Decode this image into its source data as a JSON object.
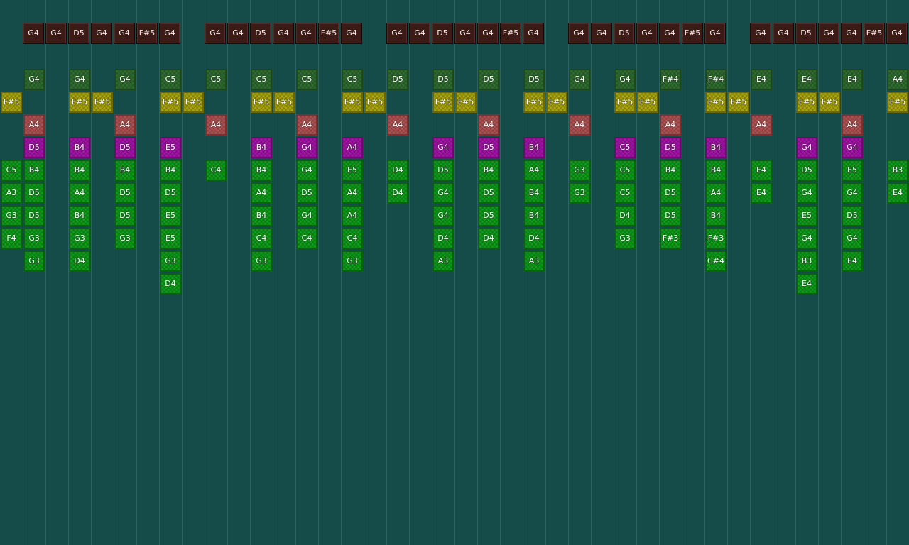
{
  "pattern": [
    [
      "G4",
      "G4",
      "D5",
      "G4",
      "G4",
      "F#5",
      "G4"
    ],
    [
      "G4",
      "G4",
      "D5",
      "G4",
      "G4",
      "F#5",
      "G4"
    ],
    [
      "G4",
      "G4",
      "D5",
      "G4",
      "G4",
      "F#5",
      "G4"
    ],
    [
      "G4",
      "G4",
      "D5",
      "G4",
      "G4",
      "F#5",
      "G4"
    ],
    [
      "G4",
      "G4",
      "D5",
      "G4",
      "G4",
      "F#5",
      "G4"
    ]
  ],
  "note_colors": {
    "dg": "#2f6b2f",
    "y": "#a8a40e",
    "r": "#ad5252",
    "m": "#a214a6",
    "g": "#0f9a1a"
  },
  "columns": [
    {
      "col": 0,
      "notes": [
        {
          "row": 1,
          "t": "y",
          "l": "F#5"
        },
        {
          "row": 4,
          "t": "g",
          "l": "C5"
        },
        {
          "row": 5,
          "t": "g",
          "l": "A3"
        },
        {
          "row": 6,
          "t": "g",
          "l": "G3"
        },
        {
          "row": 7,
          "t": "g",
          "l": "F4"
        }
      ]
    },
    {
      "col": 1,
      "notes": [
        {
          "row": 0,
          "t": "dg",
          "l": "G4"
        },
        {
          "row": 2,
          "t": "r",
          "l": "A4"
        },
        {
          "row": 3,
          "t": "m",
          "l": "D5"
        },
        {
          "row": 4,
          "t": "g",
          "l": "B4"
        },
        {
          "row": 5,
          "t": "g",
          "l": "D5"
        },
        {
          "row": 6,
          "t": "g",
          "l": "D5"
        },
        {
          "row": 7,
          "t": "g",
          "l": "G3"
        },
        {
          "row": 8,
          "t": "g",
          "l": "G3"
        }
      ]
    },
    {
      "col": 3,
      "notes": [
        {
          "row": 0,
          "t": "dg",
          "l": "G4"
        },
        {
          "row": 1,
          "t": "y",
          "l": "F#5"
        },
        {
          "row": 3,
          "t": "m",
          "l": "B4"
        },
        {
          "row": 4,
          "t": "g",
          "l": "B4"
        },
        {
          "row": 5,
          "t": "g",
          "l": "A4"
        },
        {
          "row": 6,
          "t": "g",
          "l": "B4"
        },
        {
          "row": 7,
          "t": "g",
          "l": "G3"
        },
        {
          "row": 8,
          "t": "g",
          "l": "D4"
        }
      ]
    },
    {
      "col": 4,
      "notes": [
        {
          "row": 1,
          "t": "y",
          "l": "F#5"
        }
      ]
    },
    {
      "col": 5,
      "notes": [
        {
          "row": 0,
          "t": "dg",
          "l": "G4"
        },
        {
          "row": 2,
          "t": "r",
          "l": "A4"
        },
        {
          "row": 3,
          "t": "m",
          "l": "D5"
        },
        {
          "row": 4,
          "t": "g",
          "l": "B4"
        },
        {
          "row": 5,
          "t": "g",
          "l": "D5"
        },
        {
          "row": 6,
          "t": "g",
          "l": "D5"
        },
        {
          "row": 7,
          "t": "g",
          "l": "G3"
        }
      ]
    },
    {
      "col": 7,
      "notes": [
        {
          "row": 0,
          "t": "dg",
          "l": "C5"
        },
        {
          "row": 1,
          "t": "y",
          "l": "F#5"
        },
        {
          "row": 3,
          "t": "m",
          "l": "E5"
        },
        {
          "row": 4,
          "t": "g",
          "l": "B4"
        },
        {
          "row": 5,
          "t": "g",
          "l": "D5"
        },
        {
          "row": 6,
          "t": "g",
          "l": "E5"
        },
        {
          "row": 7,
          "t": "g",
          "l": "E5"
        },
        {
          "row": 8,
          "t": "g",
          "l": "G3"
        },
        {
          "row": 9,
          "t": "g",
          "l": "D4"
        }
      ]
    },
    {
      "col": 8,
      "notes": [
        {
          "row": 1,
          "t": "y",
          "l": "F#5"
        }
      ]
    },
    {
      "col": 9,
      "notes": [
        {
          "row": 0,
          "t": "dg",
          "l": "C5"
        },
        {
          "row": 2,
          "t": "r",
          "l": "A4"
        },
        {
          "row": 4,
          "t": "g",
          "l": "C4"
        }
      ]
    },
    {
      "col": 11,
      "notes": [
        {
          "row": 0,
          "t": "dg",
          "l": "C5"
        },
        {
          "row": 1,
          "t": "y",
          "l": "F#5"
        },
        {
          "row": 3,
          "t": "m",
          "l": "B4"
        },
        {
          "row": 4,
          "t": "g",
          "l": "B4"
        },
        {
          "row": 5,
          "t": "g",
          "l": "A4"
        },
        {
          "row": 6,
          "t": "g",
          "l": "B4"
        },
        {
          "row": 7,
          "t": "g",
          "l": "C4"
        },
        {
          "row": 8,
          "t": "g",
          "l": "G3"
        }
      ]
    },
    {
      "col": 12,
      "notes": [
        {
          "row": 1,
          "t": "y",
          "l": "F#5"
        }
      ]
    },
    {
      "col": 13,
      "notes": [
        {
          "row": 0,
          "t": "dg",
          "l": "C5"
        },
        {
          "row": 2,
          "t": "r",
          "l": "A4"
        },
        {
          "row": 3,
          "t": "m",
          "l": "G4"
        },
        {
          "row": 4,
          "t": "g",
          "l": "G4"
        },
        {
          "row": 5,
          "t": "g",
          "l": "D5"
        },
        {
          "row": 6,
          "t": "g",
          "l": "G4"
        },
        {
          "row": 7,
          "t": "g",
          "l": "C4"
        }
      ]
    },
    {
      "col": 15,
      "notes": [
        {
          "row": 0,
          "t": "dg",
          "l": "C5"
        },
        {
          "row": 1,
          "t": "y",
          "l": "F#5"
        },
        {
          "row": 3,
          "t": "m",
          "l": "A4"
        },
        {
          "row": 4,
          "t": "g",
          "l": "E5"
        },
        {
          "row": 5,
          "t": "g",
          "l": "A4"
        },
        {
          "row": 6,
          "t": "g",
          "l": "A4"
        },
        {
          "row": 7,
          "t": "g",
          "l": "C4"
        },
        {
          "row": 8,
          "t": "g",
          "l": "G3"
        }
      ]
    },
    {
      "col": 16,
      "notes": [
        {
          "row": 1,
          "t": "y",
          "l": "F#5"
        }
      ]
    },
    {
      "col": 17,
      "notes": [
        {
          "row": 0,
          "t": "dg",
          "l": "D5"
        },
        {
          "row": 2,
          "t": "r",
          "l": "A4"
        },
        {
          "row": 4,
          "t": "g",
          "l": "D4"
        },
        {
          "row": 5,
          "t": "g",
          "l": "D4"
        }
      ]
    },
    {
      "col": 19,
      "notes": [
        {
          "row": 0,
          "t": "dg",
          "l": "D5"
        },
        {
          "row": 1,
          "t": "y",
          "l": "F#5"
        },
        {
          "row": 3,
          "t": "m",
          "l": "G4"
        },
        {
          "row": 4,
          "t": "g",
          "l": "D5"
        },
        {
          "row": 5,
          "t": "g",
          "l": "G4"
        },
        {
          "row": 6,
          "t": "g",
          "l": "G4"
        },
        {
          "row": 7,
          "t": "g",
          "l": "D4"
        },
        {
          "row": 8,
          "t": "g",
          "l": "A3"
        }
      ]
    },
    {
      "col": 20,
      "notes": [
        {
          "row": 1,
          "t": "y",
          "l": "F#5"
        }
      ]
    },
    {
      "col": 21,
      "notes": [
        {
          "row": 0,
          "t": "dg",
          "l": "D5"
        },
        {
          "row": 2,
          "t": "r",
          "l": "A4"
        },
        {
          "row": 3,
          "t": "m",
          "l": "D5"
        },
        {
          "row": 4,
          "t": "g",
          "l": "B4"
        },
        {
          "row": 5,
          "t": "g",
          "l": "D5"
        },
        {
          "row": 6,
          "t": "g",
          "l": "D5"
        },
        {
          "row": 7,
          "t": "g",
          "l": "D4"
        }
      ]
    },
    {
      "col": 23,
      "notes": [
        {
          "row": 0,
          "t": "dg",
          "l": "D5"
        },
        {
          "row": 1,
          "t": "y",
          "l": "F#5"
        },
        {
          "row": 3,
          "t": "m",
          "l": "B4"
        },
        {
          "row": 4,
          "t": "g",
          "l": "A4"
        },
        {
          "row": 5,
          "t": "g",
          "l": "B4"
        },
        {
          "row": 6,
          "t": "g",
          "l": "B4"
        },
        {
          "row": 7,
          "t": "g",
          "l": "D4"
        },
        {
          "row": 8,
          "t": "g",
          "l": "A3"
        }
      ]
    },
    {
      "col": 24,
      "notes": [
        {
          "row": 1,
          "t": "y",
          "l": "F#5"
        }
      ]
    },
    {
      "col": 25,
      "notes": [
        {
          "row": 0,
          "t": "dg",
          "l": "G4"
        },
        {
          "row": 2,
          "t": "r",
          "l": "A4"
        },
        {
          "row": 4,
          "t": "g",
          "l": "G3"
        },
        {
          "row": 5,
          "t": "g",
          "l": "G3"
        }
      ]
    },
    {
      "col": 27,
      "notes": [
        {
          "row": 0,
          "t": "dg",
          "l": "G4"
        },
        {
          "row": 1,
          "t": "y",
          "l": "F#5"
        },
        {
          "row": 3,
          "t": "m",
          "l": "C5"
        },
        {
          "row": 4,
          "t": "g",
          "l": "C5"
        },
        {
          "row": 5,
          "t": "g",
          "l": "C5"
        },
        {
          "row": 6,
          "t": "g",
          "l": "D4"
        },
        {
          "row": 7,
          "t": "g",
          "l": "G3"
        }
      ]
    },
    {
      "col": 28,
      "notes": [
        {
          "row": 1,
          "t": "y",
          "l": "F#5"
        }
      ]
    },
    {
      "col": 29,
      "notes": [
        {
          "row": 0,
          "t": "dg",
          "l": "F#4"
        },
        {
          "row": 2,
          "t": "r",
          "l": "A4"
        },
        {
          "row": 3,
          "t": "m",
          "l": "D5"
        },
        {
          "row": 4,
          "t": "g",
          "l": "B4"
        },
        {
          "row": 5,
          "t": "g",
          "l": "D5"
        },
        {
          "row": 6,
          "t": "g",
          "l": "D5"
        },
        {
          "row": 7,
          "t": "g",
          "l": "F#3"
        }
      ]
    },
    {
      "col": 31,
      "notes": [
        {
          "row": 0,
          "t": "dg",
          "l": "F#4"
        },
        {
          "row": 1,
          "t": "y",
          "l": "F#5"
        },
        {
          "row": 3,
          "t": "m",
          "l": "B4"
        },
        {
          "row": 4,
          "t": "g",
          "l": "B4"
        },
        {
          "row": 5,
          "t": "g",
          "l": "A4"
        },
        {
          "row": 6,
          "t": "g",
          "l": "B4"
        },
        {
          "row": 7,
          "t": "g",
          "l": "F#3"
        },
        {
          "row": 8,
          "t": "g",
          "l": "C#4"
        }
      ]
    },
    {
      "col": 32,
      "notes": [
        {
          "row": 1,
          "t": "y",
          "l": "F#5"
        }
      ]
    },
    {
      "col": 33,
      "notes": [
        {
          "row": 0,
          "t": "dg",
          "l": "E4"
        },
        {
          "row": 2,
          "t": "r",
          "l": "A4"
        },
        {
          "row": 4,
          "t": "g",
          "l": "E4"
        },
        {
          "row": 5,
          "t": "g",
          "l": "E4"
        }
      ]
    },
    {
      "col": 35,
      "notes": [
        {
          "row": 0,
          "t": "dg",
          "l": "E4"
        },
        {
          "row": 1,
          "t": "y",
          "l": "F#5"
        },
        {
          "row": 3,
          "t": "m",
          "l": "G4"
        },
        {
          "row": 4,
          "t": "g",
          "l": "D5"
        },
        {
          "row": 5,
          "t": "g",
          "l": "G4"
        },
        {
          "row": 6,
          "t": "g",
          "l": "E5"
        },
        {
          "row": 7,
          "t": "g",
          "l": "G4"
        },
        {
          "row": 8,
          "t": "g",
          "l": "B3"
        },
        {
          "row": 9,
          "t": "g",
          "l": "E4"
        }
      ]
    },
    {
      "col": 36,
      "notes": [
        {
          "row": 1,
          "t": "y",
          "l": "F#5"
        }
      ]
    },
    {
      "col": 37,
      "notes": [
        {
          "row": 0,
          "t": "dg",
          "l": "E4"
        },
        {
          "row": 2,
          "t": "r",
          "l": "A4"
        },
        {
          "row": 3,
          "t": "m",
          "l": "G4"
        },
        {
          "row": 4,
          "t": "g",
          "l": "E5"
        },
        {
          "row": 5,
          "t": "g",
          "l": "G4"
        },
        {
          "row": 6,
          "t": "g",
          "l": "D5"
        },
        {
          "row": 7,
          "t": "g",
          "l": "G4"
        },
        {
          "row": 8,
          "t": "g",
          "l": "E4"
        }
      ]
    },
    {
      "col": 39,
      "notes": [
        {
          "row": 0,
          "t": "dg",
          "l": "A4"
        },
        {
          "row": 1,
          "t": "y",
          "l": "F#5"
        },
        {
          "row": 4,
          "t": "g",
          "l": "B3"
        },
        {
          "row": 5,
          "t": "g",
          "l": "E4"
        }
      ]
    }
  ]
}
